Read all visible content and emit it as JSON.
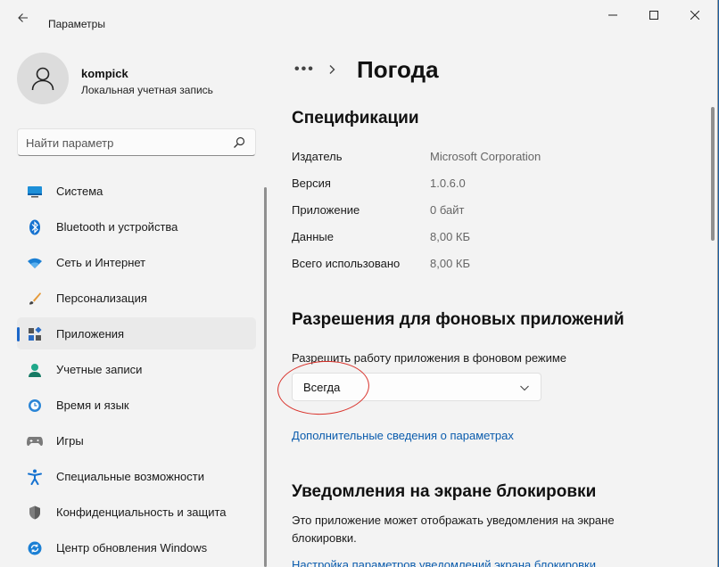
{
  "window": {
    "app_title": "Параметры"
  },
  "profile": {
    "name": "kompick",
    "account_type": "Локальная учетная запись"
  },
  "search": {
    "placeholder": "Найти параметр"
  },
  "sidebar": {
    "items": [
      {
        "label": "Система",
        "icon": "system-icon",
        "active": false
      },
      {
        "label": "Bluetooth и устройства",
        "icon": "bluetooth-icon",
        "active": false
      },
      {
        "label": "Сеть и Интернет",
        "icon": "wifi-icon",
        "active": false
      },
      {
        "label": "Персонализация",
        "icon": "brush-icon",
        "active": false
      },
      {
        "label": "Приложения",
        "icon": "apps-icon",
        "active": true
      },
      {
        "label": "Учетные записи",
        "icon": "accounts-icon",
        "active": false
      },
      {
        "label": "Время и язык",
        "icon": "time-language-icon",
        "active": false
      },
      {
        "label": "Игры",
        "icon": "gamepad-icon",
        "active": false
      },
      {
        "label": "Специальные возможности",
        "icon": "accessibility-icon",
        "active": false
      },
      {
        "label": "Конфиденциальность и защита",
        "icon": "shield-icon",
        "active": false
      },
      {
        "label": "Центр обновления Windows",
        "icon": "update-icon",
        "active": false
      }
    ]
  },
  "breadcrumb": {
    "more": "•••",
    "title": "Погода"
  },
  "specs": {
    "heading": "Спецификации",
    "rows": [
      {
        "label": "Издатель",
        "value": "Microsoft Corporation"
      },
      {
        "label": "Версия",
        "value": "1.0.6.0"
      },
      {
        "label": "Приложение",
        "value": "0 байт"
      },
      {
        "label": "Данные",
        "value": "8,00 КБ"
      },
      {
        "label": "Всего использовано",
        "value": "8,00 КБ"
      }
    ]
  },
  "permissions": {
    "heading": "Разрешения для фоновых приложений",
    "label": "Разрешить работу приложения в фоновом режиме",
    "selected": "Всегда",
    "more_link": "Дополнительные сведения о параметрах"
  },
  "lockscreen": {
    "heading": "Уведомления на экране блокировки",
    "description": "Это приложение может отображать уведомления на экране блокировки.",
    "link": "Настройка параметров уведомлений экрана блокировки"
  },
  "colors": {
    "accent": "#1b66c9",
    "link": "#0b5cad",
    "annotation": "#d9322b"
  }
}
